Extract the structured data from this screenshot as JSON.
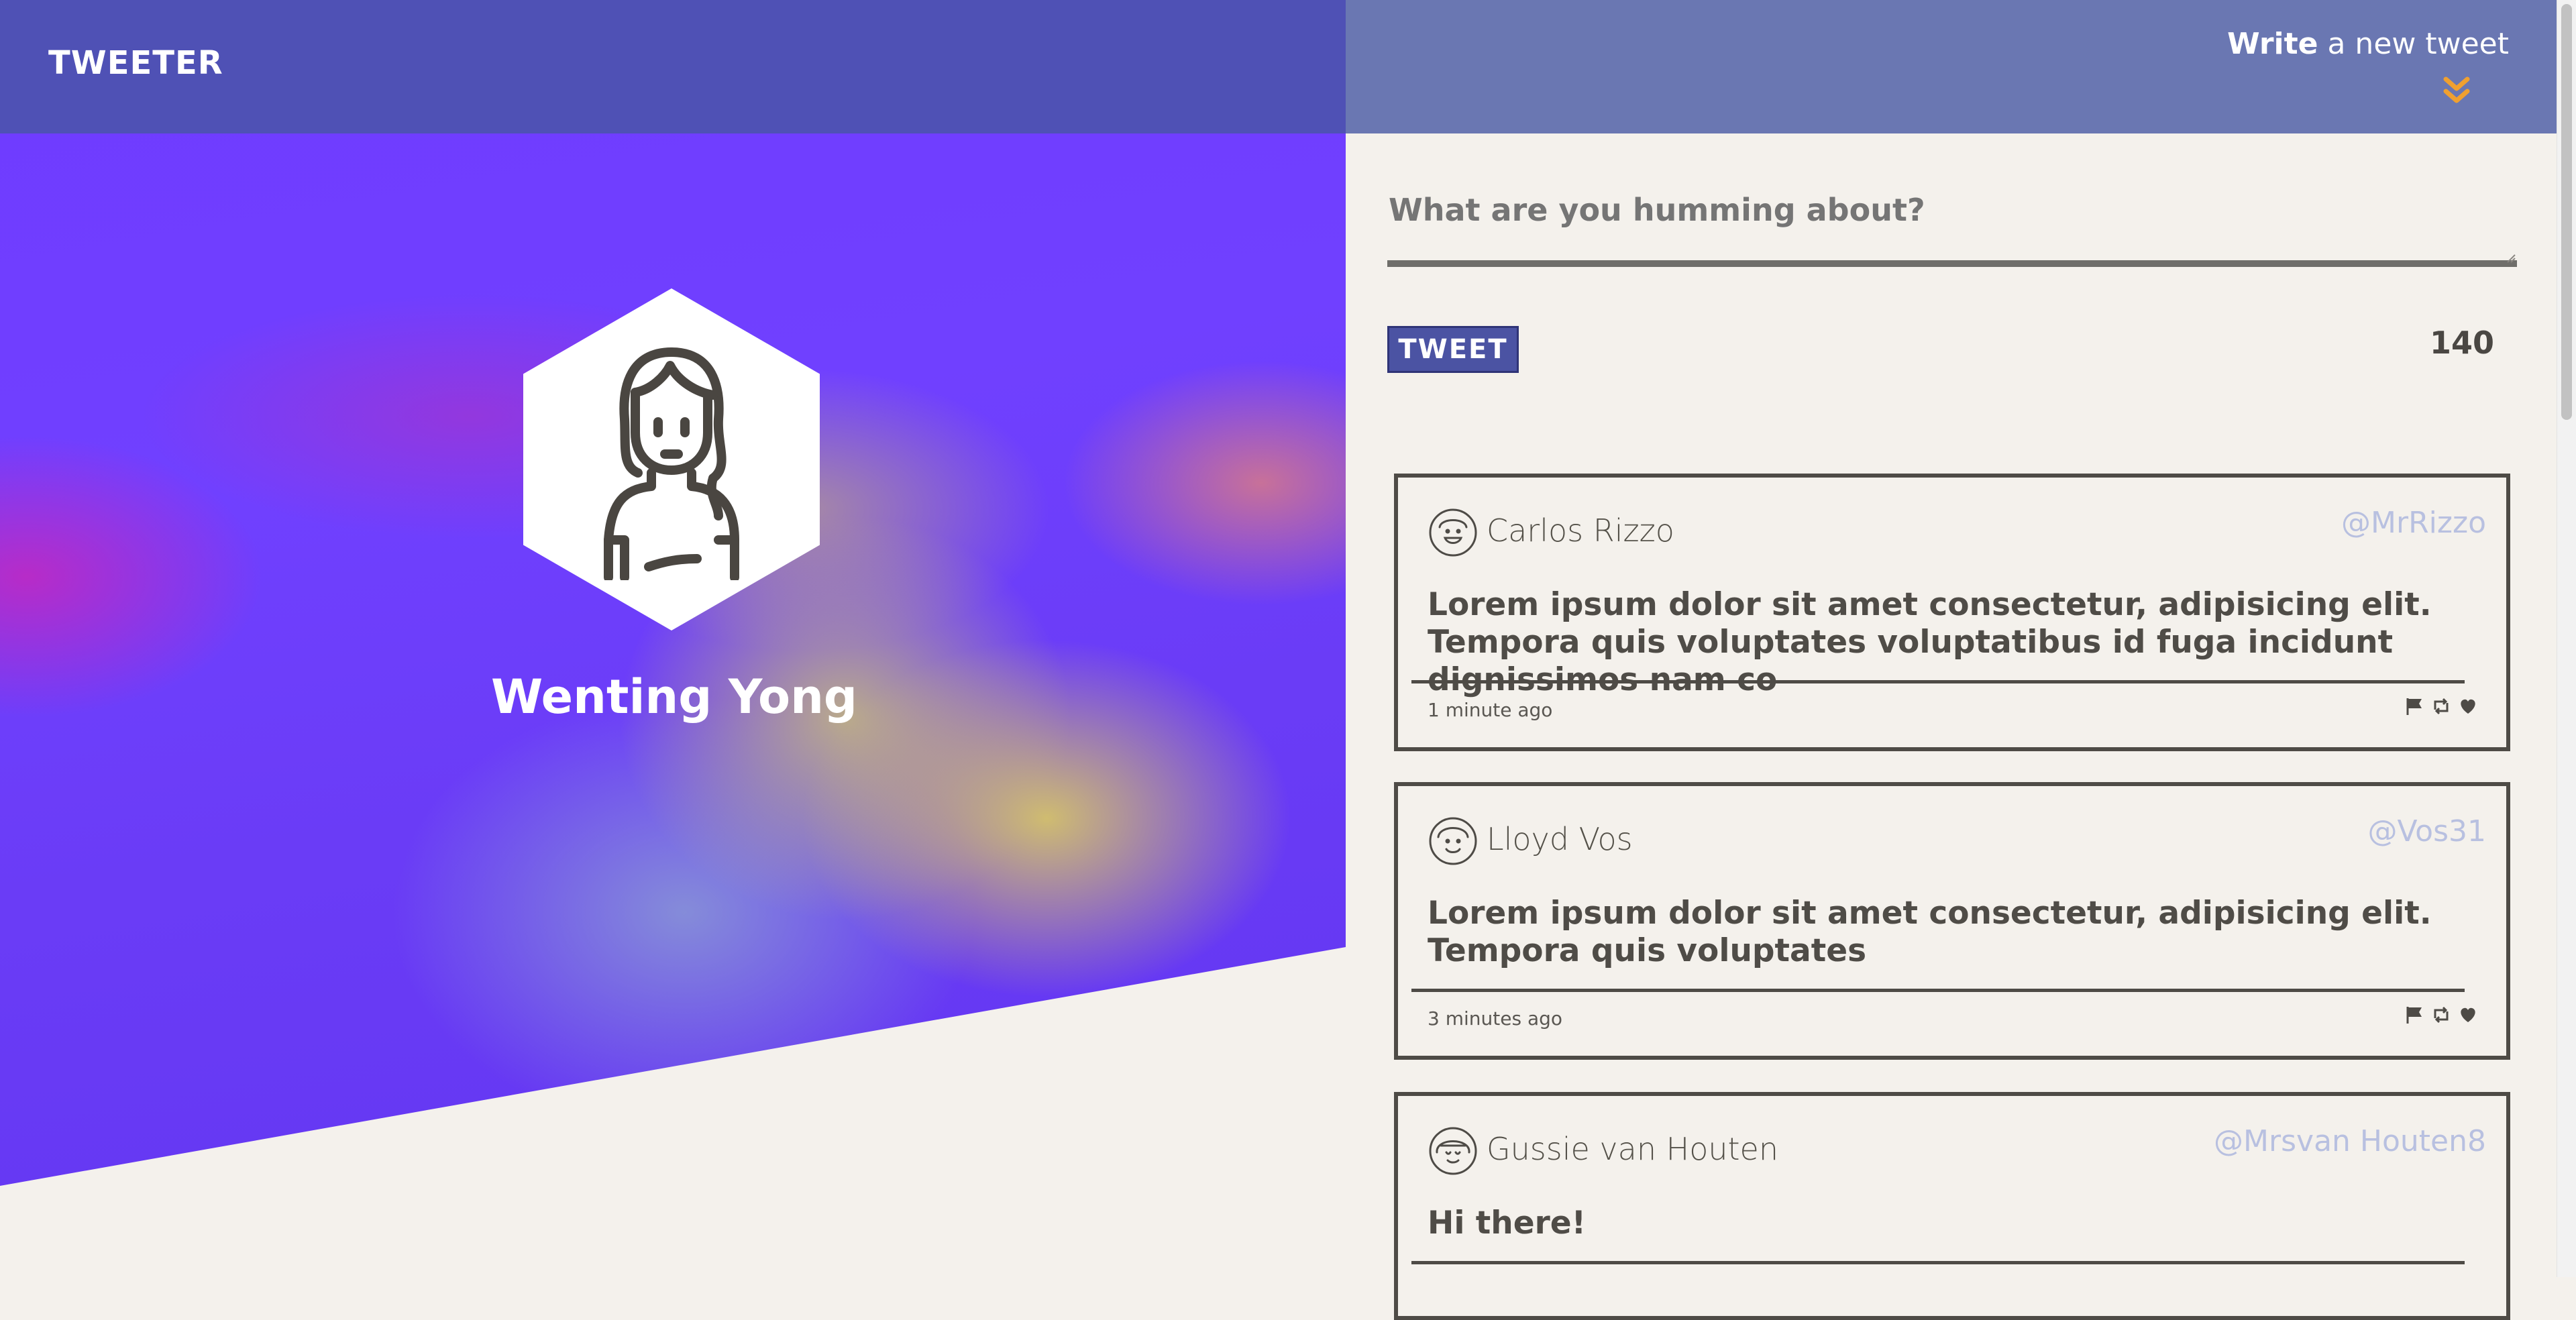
{
  "app": {
    "logo": "TWEETER"
  },
  "profile": {
    "name": "Wenting Yong",
    "avatar_icon": "woman-avatar-icon"
  },
  "composer": {
    "toggle_bold": "Write",
    "toggle_rest": " a new tweet",
    "toggle_icon": "double-chevron-down-icon",
    "placeholder": "What are you humming about?",
    "button_label": "TWEET",
    "counter": "140"
  },
  "tweets": [
    {
      "name": "Carlos Rizzo",
      "handle": "@MrRizzo",
      "text": "Lorem ipsum dolor sit amet consectetur, adipisicing elit. Tempora quis voluptates voluptatibus id fuga incidunt dignissimos nam co",
      "time": "1 minute ago",
      "avatar_icon": "smiling-man-avatar-icon"
    },
    {
      "name": "Lloyd Vos",
      "handle": "@Vos31",
      "text": "Lorem ipsum dolor sit amet consectetur, adipisicing elit. Tempora quis voluptates",
      "time": "3 minutes ago",
      "avatar_icon": "man-avatar-icon"
    },
    {
      "name": "Gussie van Houten",
      "handle": "@Mrsvan Houten8",
      "text": "Hi there!",
      "time": "",
      "avatar_icon": "woman-bangs-avatar-icon"
    }
  ],
  "colors": {
    "header_left": "#4e52b2",
    "header_right": "#6a77b2",
    "accent_chevron": "#f0a030",
    "button": "#4b53a3",
    "background": "#f4f1ec",
    "handle": "#b8c0e0"
  }
}
